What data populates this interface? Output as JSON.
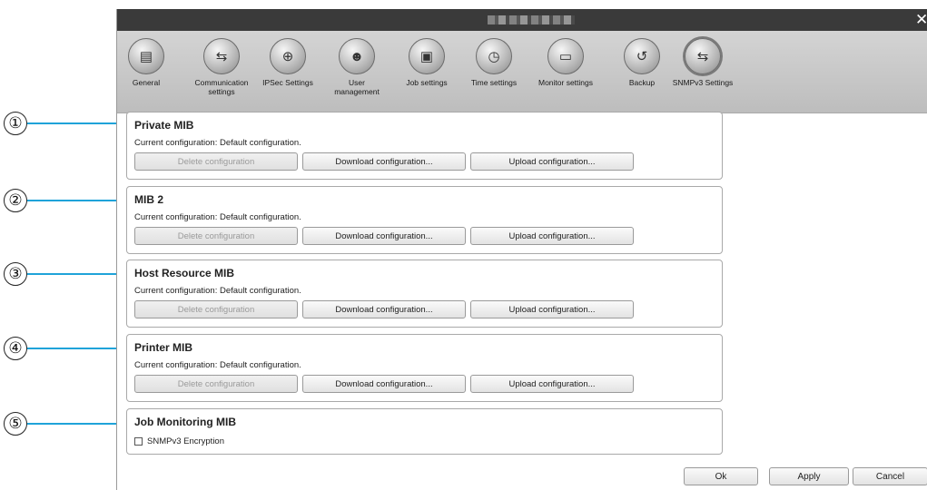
{
  "callouts": [
    "①",
    "②",
    "③",
    "④",
    "⑤"
  ],
  "colors": {
    "callout_line": "#1fa3d9",
    "titlebar": "#3a3a3a"
  },
  "window": {
    "close_symbol": "✕"
  },
  "toolbar": {
    "items": [
      {
        "label": "General",
        "icon": "general-icon",
        "active": false
      },
      {
        "label": "Communication settings",
        "icon": "communication-icon",
        "active": false
      },
      {
        "label": "IPSec Settings",
        "icon": "ipsec-icon",
        "active": false
      },
      {
        "label": "User management",
        "icon": "user-management-icon",
        "active": false
      },
      {
        "label": "Job settings",
        "icon": "job-settings-icon",
        "active": false
      },
      {
        "label": "Time settings",
        "icon": "clock-icon",
        "active": false
      },
      {
        "label": "Monitor settings",
        "icon": "monitor-icon",
        "active": false
      },
      {
        "label": "Backup",
        "icon": "backup-icon",
        "active": false
      },
      {
        "label": "SNMPv3 Settings",
        "icon": "snmpv3-icon",
        "active": true
      }
    ]
  },
  "panels": [
    {
      "title": "Private MIB",
      "description": "Current configuration: Default configuration.",
      "buttons": [
        "Delete configuration",
        "Download configuration...",
        "Upload configuration..."
      ]
    },
    {
      "title": "MIB 2",
      "description": "Current configuration: Default configuration.",
      "buttons": [
        "Delete configuration",
        "Download configuration...",
        "Upload configuration..."
      ]
    },
    {
      "title": "Host Resource MIB",
      "description": "Current configuration: Default configuration.",
      "buttons": [
        "Delete configuration",
        "Download configuration...",
        "Upload configuration..."
      ]
    },
    {
      "title": "Printer MIB",
      "description": "Current configuration: Default configuration.",
      "buttons": [
        "Delete configuration",
        "Download configuration...",
        "Upload configuration..."
      ]
    },
    {
      "title": "Job Monitoring MIB",
      "checkbox": {
        "label": "SNMPv3 Encryption",
        "checked": false
      }
    }
  ],
  "footer": {
    "ok": "Ok",
    "apply": "Apply",
    "cancel": "Cancel"
  }
}
